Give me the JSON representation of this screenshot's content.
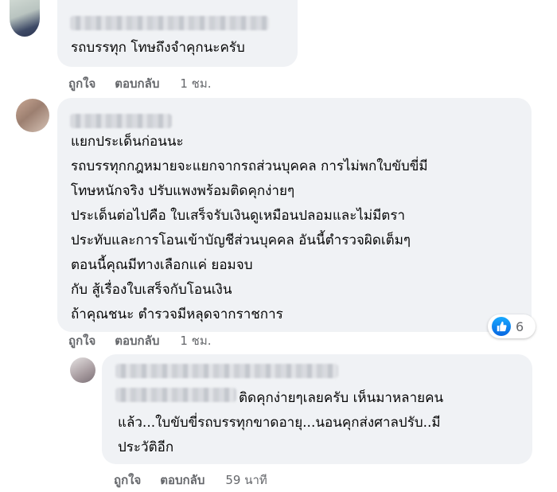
{
  "comments": [
    {
      "text": [
        "รถบรรทุก โทษถึงจำคุกนะครับ"
      ],
      "actions": {
        "like": "ถูกใจ",
        "reply": "ตอบกลับ",
        "time": "1 ชม."
      }
    },
    {
      "text": [
        "แยกประเด็นก่อนนะ",
        "รถบรรทุกกฎหมายจะแยกจากรถส่วนบุคคล การไม่พกใบขับขี่มี",
        "โทษหนักจริง ปรับแพงพร้อมติดคุกง่ายๆ",
        "ประเด็นต่อไปคือ ใบเสร็จรับเงินดูเหมือนปลอมและไม่มีตรา",
        "ประทับและการโอนเข้าบัญชีส่วนบุคคล อันนี้ตำรวจผิดเต็มๆ",
        "ตอนนี้คุณมีทางเลือกแค่ ยอมจบ",
        "กับ สู้เรื่องใบเสร็จกับโอนเงิน",
        "ถ้าคุณชนะ ตำรวจมีหลุดจากราชการ"
      ],
      "reaction": {
        "icon": "like-icon",
        "count": "6"
      },
      "actions": {
        "like": "ถูกใจ",
        "reply": "ตอบกลับ",
        "time": "1 ชม."
      }
    },
    {
      "text": [
        "ติดคุกง่ายๆเลยครับ เห็นมาหลายคน",
        "แล้ว...ใบขับขี่รถบรรทุกขาดอายุ...นอนคุกส่งศาลปรับ..มี",
        "ประวัติอีก"
      ],
      "actions": {
        "like": "ถูกใจ",
        "reply": "ตอบกลับ",
        "time": "59 นาที"
      }
    }
  ],
  "colors": {
    "bubble": "#f0f2f5",
    "meta": "#65676b",
    "like_blue": "#1877f2"
  }
}
